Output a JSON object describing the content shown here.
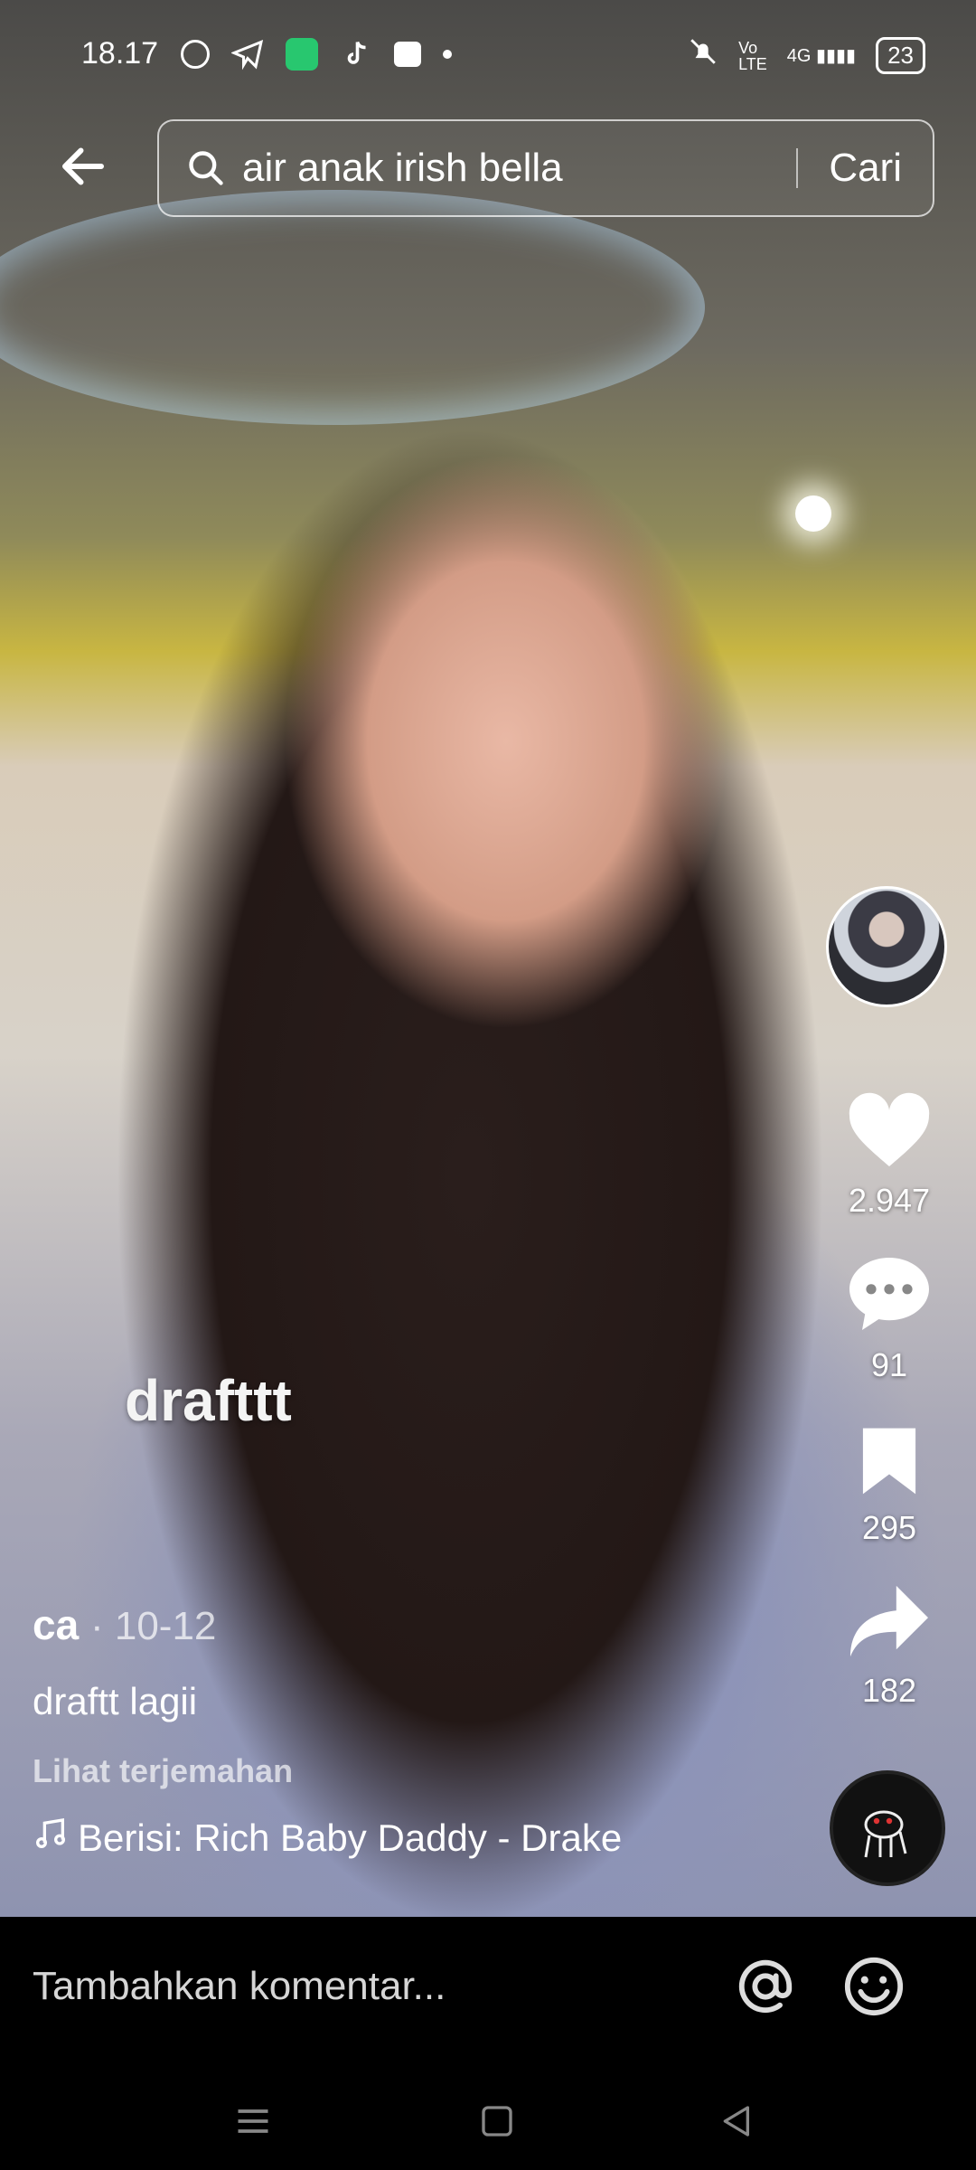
{
  "status_bar": {
    "time": "18.17",
    "battery": "23",
    "network": "4G"
  },
  "search": {
    "query": "air anak irish bella",
    "button_label": "Cari"
  },
  "video": {
    "overlay_caption": "drafttt"
  },
  "rail": {
    "likes": "2.947",
    "comments": "91",
    "saves": "295",
    "shares": "182"
  },
  "post": {
    "author": "ca",
    "date": "10-12",
    "description": "draftt lagii",
    "translate_label": "Lihat terjemahan",
    "music": "Berisi: Rich Baby Daddy - Drake"
  },
  "comment_bar": {
    "placeholder": "Tambahkan komentar..."
  },
  "icons": {
    "back": "arrow-left-icon",
    "search": "search-icon",
    "like": "heart-icon",
    "comment": "comment-icon",
    "save": "bookmark-icon",
    "share": "share-icon",
    "mention": "at-icon",
    "emoji": "emoji-icon"
  },
  "colors": {
    "text": "#ffffff",
    "background": "#000000"
  }
}
